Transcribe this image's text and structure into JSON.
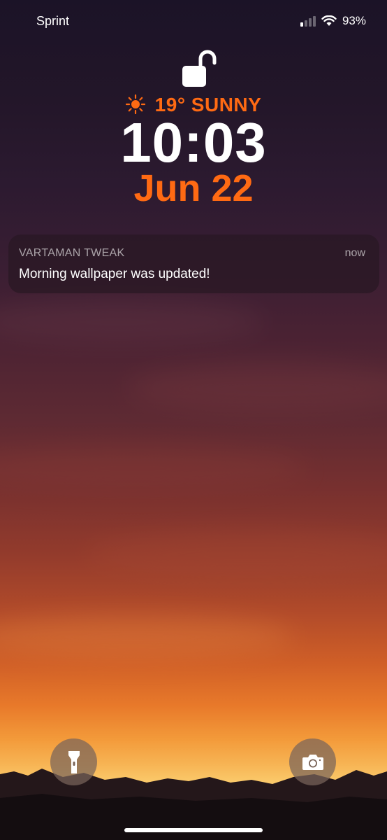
{
  "status_bar": {
    "carrier": "Sprint",
    "signal_bars_active": 1,
    "battery": "93%",
    "icons": [
      "signal-icon",
      "wifi-icon"
    ]
  },
  "lock_screen": {
    "lock_state": "unlocked",
    "weather": {
      "icon": "sun-icon",
      "text": "19° SUNNY"
    },
    "time": "10:03",
    "date": "Jun 22",
    "accent_color": "#ff6a13"
  },
  "notification": {
    "app": "VARTAMAN TWEAK",
    "time": "now",
    "body": "Morning wallpaper was updated!"
  },
  "quick_actions": {
    "left": "flashlight-icon",
    "right": "camera-icon"
  }
}
